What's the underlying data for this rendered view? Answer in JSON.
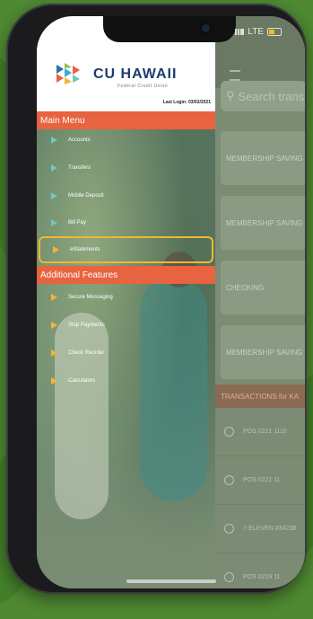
{
  "status": {
    "network": "LTE"
  },
  "brand": {
    "name": "CU HAWAII",
    "subtitle": "Federal Credit Union",
    "last_login": "Last Login: 03/02/2021"
  },
  "menu": {
    "main_title": "Main Menu",
    "items": [
      {
        "label": "Accounts",
        "icon": "chevron-right-icon"
      },
      {
        "label": "Transfers",
        "icon": "chevron-right-icon"
      },
      {
        "label": "Mobile Deposit",
        "icon": "chevron-right-icon"
      },
      {
        "label": "Bill Pay",
        "icon": "chevron-right-icon"
      },
      {
        "label": "eStatements",
        "icon": "chevron-right-icon",
        "selected": true
      }
    ],
    "additional_title": "Additional Features",
    "additional_items": [
      {
        "label": "Secure Messaging"
      },
      {
        "label": "Stop Payments"
      },
      {
        "label": "Check Reorder"
      },
      {
        "label": "Calculators"
      }
    ]
  },
  "app": {
    "search_placeholder": "Search trans",
    "accounts": [
      "MEMBERSHIP SAVING",
      "MEMBERSHIP SAVING",
      "CHECKING",
      "MEMBERSHIP SAVING"
    ],
    "transactions_title": "TRANSACTIONS for KA",
    "transactions": [
      "POS 0221 1116",
      "POS 0221 11",
      "7-ELEVEN #34238",
      "POS 0219 11"
    ]
  },
  "colors": {
    "accent": "#e8633f",
    "highlight": "#f1b733",
    "brand_blue": "#1d3b6d",
    "teal_arrow": "#6fc7c0",
    "orange_arrow": "#f4b437"
  }
}
